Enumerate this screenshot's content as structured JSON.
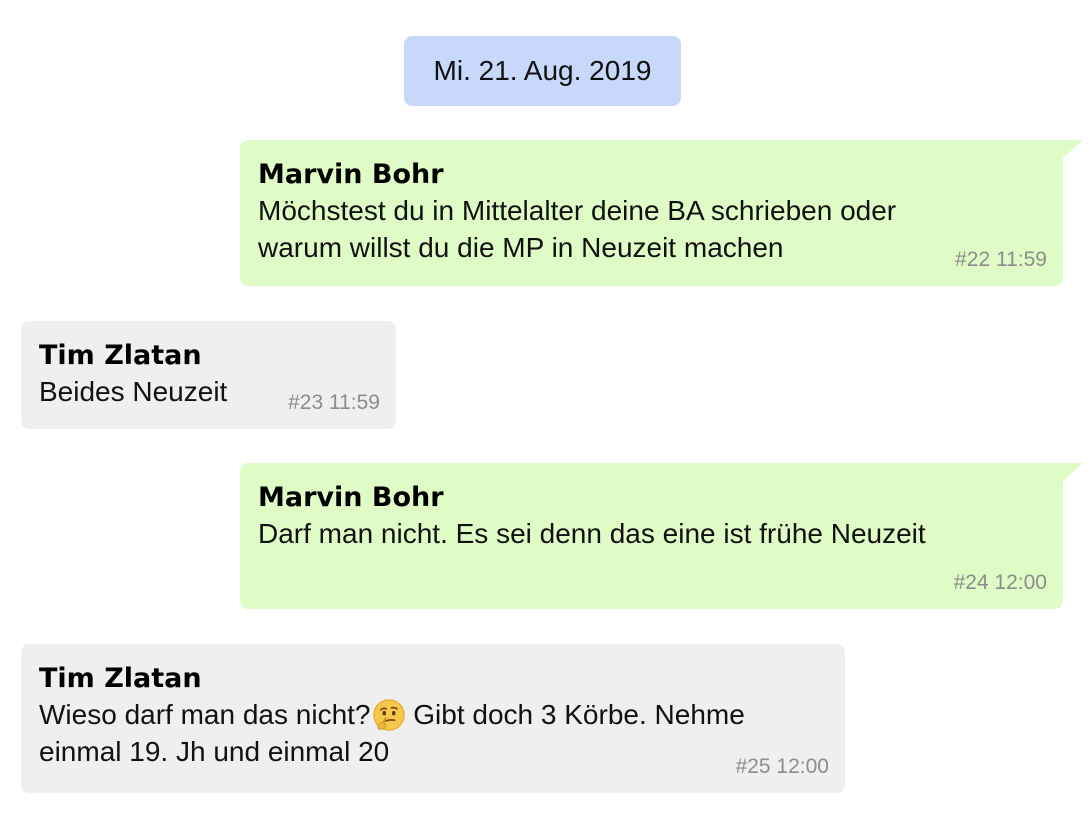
{
  "date_separator": "Mi. 21. Aug. 2019",
  "messages": [
    {
      "sender": "Marvin Bohr",
      "text_line1": "Möchstest du in Mittelalter deine BA schrieben oder",
      "text_line2": "warum willst du die MP in Neuzeit machen",
      "meta": "#22 11:59",
      "direction": "outgoing"
    },
    {
      "sender": "Tim Zlatan",
      "text": "Beides Neuzeit",
      "meta": "#23 11:59",
      "direction": "incoming"
    },
    {
      "sender": "Marvin Bohr",
      "text": "Darf man nicht. Es sei denn das eine ist frühe Neuzeit",
      "meta": "#24 12:00",
      "direction": "outgoing"
    },
    {
      "sender": "Tim Zlatan",
      "text_before_emoji": "Wieso darf man das nicht?",
      "emoji": "thinking-face-icon",
      "text_after_emoji": " Gibt doch 3 Körbe. Nehme",
      "text_line2": "einmal 19. Jh und einmal 20",
      "meta": "#25 12:00",
      "direction": "incoming"
    }
  ],
  "colors": {
    "outgoing_bubble": "#e0fcc6",
    "incoming_bubble": "#efefef",
    "date_pill": "#c8d8fa",
    "meta_text": "#8c8c8c"
  }
}
